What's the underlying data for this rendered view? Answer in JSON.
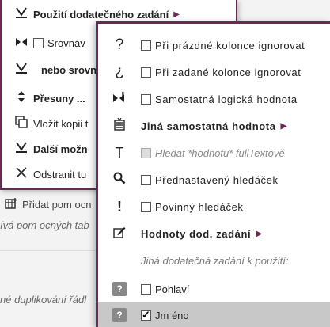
{
  "background": {
    "add_label": "Přidat pom ocn",
    "hint_line": "ívá pom ocných tab",
    "dup_line": "né duplikování řádl"
  },
  "back_menu": {
    "items": [
      {
        "icon": "down-tick-icon",
        "label": "Použití dodatečného zadání"
      },
      {
        "icon": "bowtie-icon",
        "label": "Srovnáv"
      },
      {
        "icon": "down-tick-icon",
        "label": "nebo srovn"
      },
      {
        "icon": "updown-icon",
        "label": "Přesuny ..."
      },
      {
        "icon": "copy-icon",
        "label": "Vložit kopii t"
      },
      {
        "icon": "down-tick-icon",
        "label": "Další možn"
      },
      {
        "icon": "close-icon",
        "label": "Odstranit tu"
      }
    ]
  },
  "front_menu": {
    "items": [
      {
        "icon": "question-icon",
        "label": "Při prázdné kolonce ignorovat"
      },
      {
        "icon": "inverted-question-icon",
        "label": "Při zadané kolonce ignorovat"
      },
      {
        "icon": "bowtie-flag-icon",
        "label": "Samostatná logická hodnota"
      },
      {
        "icon": "list-icon",
        "label": "Jiná samostatná hodnota"
      },
      {
        "icon": "text-t-icon",
        "label": "Hledat *hodnotu* fullTextově"
      },
      {
        "icon": "magnifier-icon",
        "label": "Přednastavený hledáček"
      },
      {
        "icon": "exclamation-icon",
        "label": "Povinný hledáček"
      },
      {
        "icon": "edit-icon",
        "label": "Hodnoty dod. zadání"
      },
      {
        "icon": "",
        "label": "Jiná dodatečná zadání k použití:"
      },
      {
        "icon": "question-box-icon",
        "label": "Pohlaví"
      },
      {
        "icon": "question-box-icon",
        "label": "Jm éno"
      }
    ]
  },
  "colors": {
    "accent": "#6b2a55",
    "selected": "#c8c8c8"
  }
}
